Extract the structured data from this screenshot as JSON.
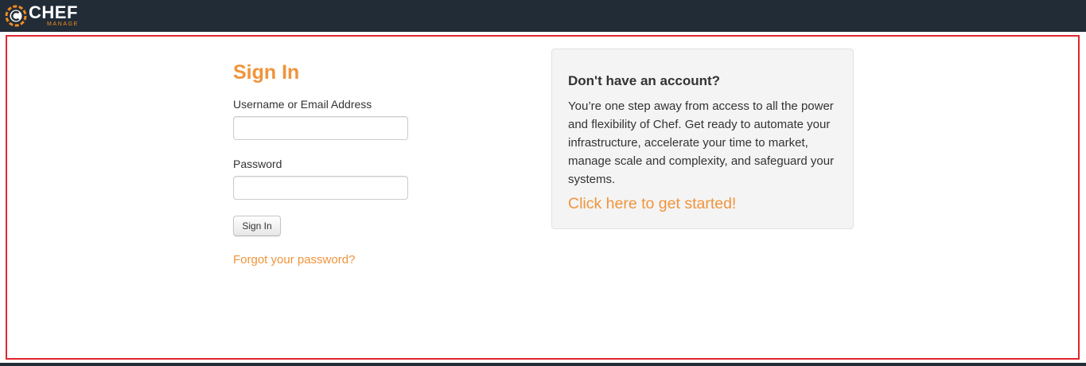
{
  "header": {
    "logo_text": "CHEF",
    "logo_subtext": "MANAGE"
  },
  "signin": {
    "title": "Sign In",
    "username_label": "Username or Email Address",
    "username_value": "",
    "password_label": "Password",
    "password_value": "",
    "submit_label": "Sign In",
    "forgot_link": "Forgot your password?"
  },
  "signup": {
    "heading": "Don't have an account?",
    "body": "You’re one step away from access to all the power and flexibility of Chef. Get ready to automate your infrastructure, accelerate your time to market, manage scale and complexity, and safeguard your systems.",
    "cta_link": "Click here to get started!"
  },
  "colors": {
    "accent": "#f0943b",
    "header_bg": "#222c37",
    "highlight_border": "#e0262f",
    "panel_bg": "#f4f4f4"
  },
  "icons": {
    "logo": "chef-logo-icon"
  }
}
